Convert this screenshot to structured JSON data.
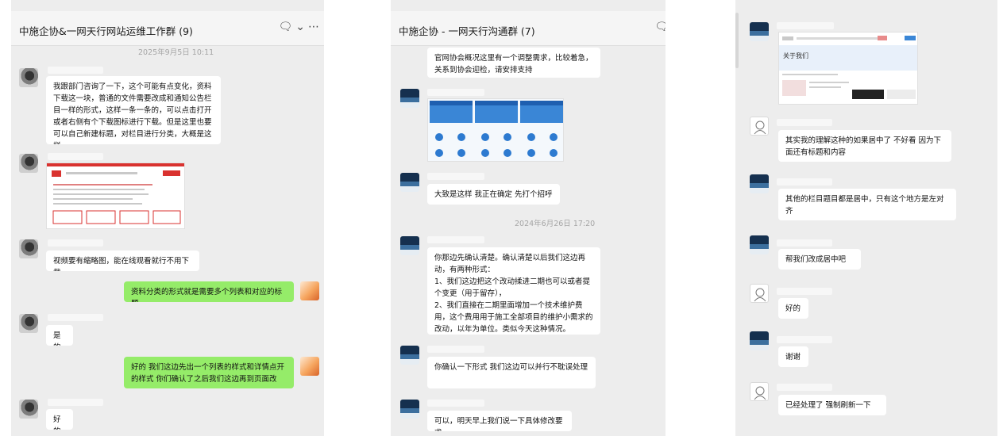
{
  "panel1": {
    "title": "中施企协&一网天行网站运维工作群 (9)",
    "icons": [
      "chat-bubble-icon",
      "chevron-down-icon",
      "more-icon"
    ],
    "timestamp": "2025年9月5日 10:11",
    "messages": [
      {
        "text": "我跟部门咨询了一下，这个可能有点变化，资料下载这一块，普通的文件需要改成和通知公告栏目一样的形式，这样一条一条的，可以点击打开或者右侧有个下载图标进行下载。但是这里也要可以自己新建标题，对栏目进行分类，大概是这样"
      },
      {
        "text": "视频要有缩略图，能在线观看就行不用下载"
      },
      {
        "text": "资料分类的形式就是需要多个列表和对应的标题"
      },
      {
        "text": "是的"
      },
      {
        "text": "好的  我们这边先出一个列表的样式和详情点开的样式 你们确认了之后我们这边再到页面改"
      },
      {
        "text": "好的"
      }
    ]
  },
  "panel2": {
    "title": "中施企协 - 一网天行沟通群 (7)",
    "icons": [
      "chat-bubble-icon"
    ],
    "timestamp": "2024年6月26日 17:20",
    "messages": [
      {
        "text": "官网协会概况这里有一个调整需求，比较着急，关系到协会迎检，请安排支持"
      },
      {
        "text": "大致是这样  我正在确定  先打个招呼"
      },
      {
        "text": "你那边先确认清楚。确认清楚以后我们这边再动，有两种形式：\n1、我们这边把这个改动揉进二期也可以或者提个变更（用于留存），\n2、我们直接在二期里面增加一个技术维护费用，这个费用用于施工全部项目的维护小需求的改动，以年为单位。类似今天这种情况。"
      },
      {
        "text": "你确认一下形式 我们这边可以并行不耽误处理"
      },
      {
        "text": "可以，明天早上我们说一下具体修改要求"
      }
    ]
  },
  "panel3": {
    "messages": [
      {
        "text": "其实我的理解这种的如果居中了 不好看  因为下面还有标题和内容"
      },
      {
        "text": "其他的栏目题目都是居中，只有这个地方是左对齐"
      },
      {
        "text": "帮我们改成居中吧"
      },
      {
        "text": "好的"
      },
      {
        "text": "谢谢"
      },
      {
        "text": "已经处理了  强制刷新一下"
      }
    ],
    "image_caption": "关于我们"
  },
  "colors": {
    "panel_bg": "#ededed",
    "self_bubble": "#95ec69",
    "other_bubble": "#ffffff",
    "accent_red": "#d9322f"
  }
}
